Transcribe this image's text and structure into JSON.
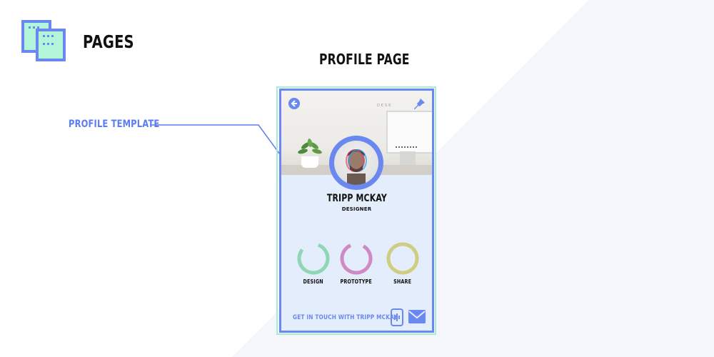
{
  "header": {
    "section_title": "PAGES",
    "screen_title": "PROFILE PAGE"
  },
  "annotation": {
    "label": "PROFILE TEMPLATE"
  },
  "profile": {
    "hero_text": "DESK",
    "name": "TRIPP MCKAY",
    "role": "DESIGNER",
    "stats": [
      {
        "label": "DESIGN",
        "color": "#8fd6b4",
        "fill": 0.8
      },
      {
        "label": "PROTOTYPE",
        "color": "#cf8ac4",
        "fill": 0.85
      },
      {
        "label": "SHARE",
        "color": "#cfcd82",
        "fill": 1.0
      }
    ],
    "contact_text": "GET IN TOUCH WITH TRIPP MCKAY"
  },
  "colors": {
    "accent": "#6a88f0",
    "frame": "#a6edd8",
    "screen_bg": "#e4edfb"
  },
  "icons": [
    "pages-icon",
    "back-arrow-icon",
    "pin-icon",
    "phone-icon",
    "mail-icon"
  ]
}
